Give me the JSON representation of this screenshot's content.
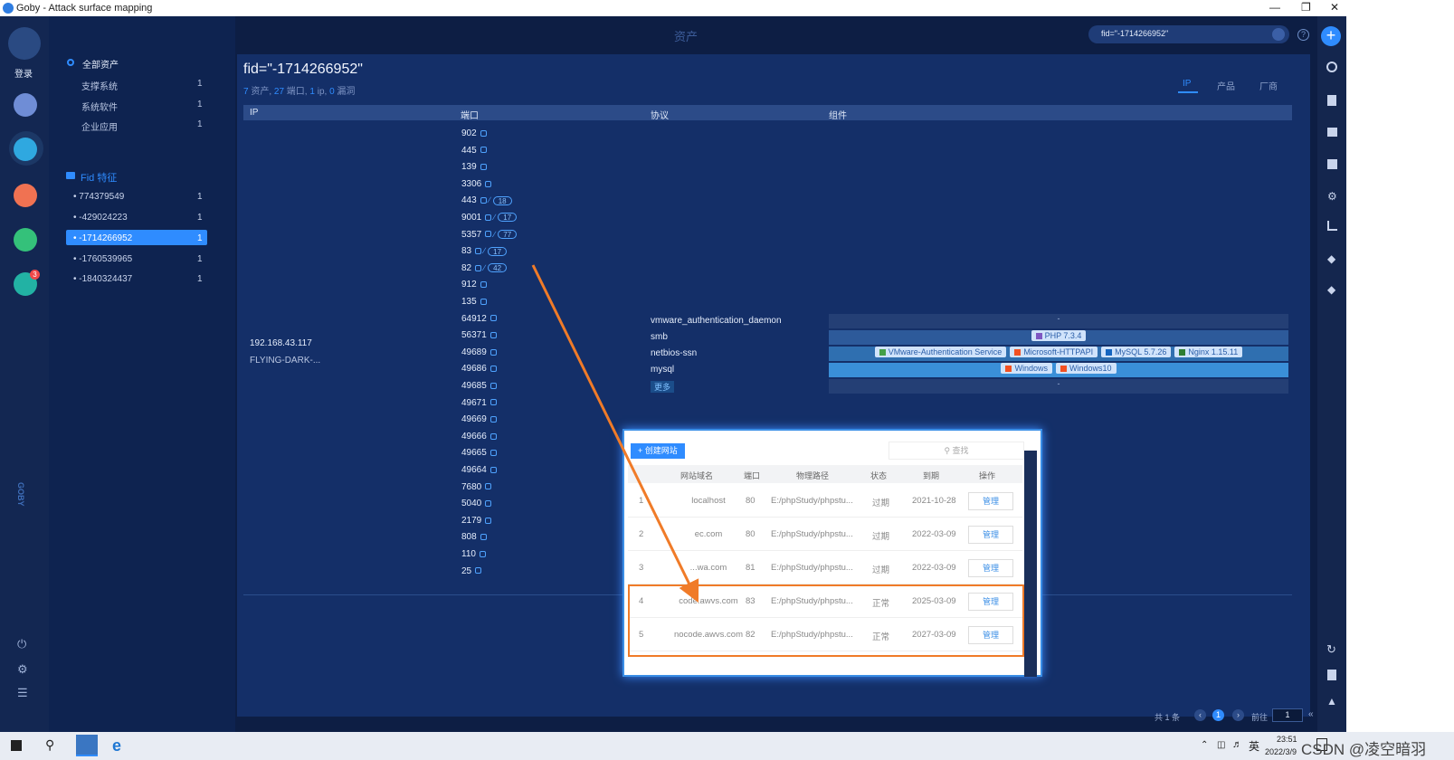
{
  "window": {
    "title": "Goby - Attack surface mapping"
  },
  "header": {
    "page_label": "资产",
    "search_value": "fid=\"-1714266952\""
  },
  "leftbar": {
    "login_label": "登录",
    "plugin_badge": "3",
    "brand": "GOBY"
  },
  "sidebar": {
    "all_assets_label": "全部资产",
    "tree": [
      {
        "label": "支撑系统",
        "count": "1"
      },
      {
        "label": "系统软件",
        "count": "1"
      },
      {
        "label": "企业应用",
        "count": "1"
      }
    ],
    "fid_header": "Fid 特征",
    "fid_items": [
      {
        "label": "774379549",
        "count": "1"
      },
      {
        "label": "-429024223",
        "count": "1"
      },
      {
        "label": "-1714266952",
        "count": "1",
        "active": true
      },
      {
        "label": "-1760539965",
        "count": "1"
      },
      {
        "label": "-1840324437",
        "count": "1"
      }
    ]
  },
  "main": {
    "query_title": "fid=\"-1714266952\"",
    "summary": {
      "assets_num": "7",
      "assets_label": " 资产, ",
      "ports_num": "27",
      "ports_label": " 端口, ",
      "ip_num": "1",
      "ip_label": " ip, ",
      "vuln_num": "0",
      "vuln_label": " 漏洞"
    },
    "view_tabs": [
      "IP",
      "产品",
      "厂商"
    ],
    "columns": [
      "IP",
      "端口",
      "协议",
      "组件"
    ],
    "host": {
      "ip": "192.168.43.117",
      "hostname": "FLYING-DARK-..."
    },
    "ports": [
      {
        "p": "902"
      },
      {
        "p": "445"
      },
      {
        "p": "139"
      },
      {
        "p": "3306"
      },
      {
        "p": "443",
        "badge": "18"
      },
      {
        "p": "9001",
        "badge": "17"
      },
      {
        "p": "5357",
        "badge": "77"
      },
      {
        "p": "83",
        "badge": "17"
      },
      {
        "p": "82",
        "badge": "42"
      },
      {
        "p": "912"
      },
      {
        "p": "135"
      },
      {
        "p": "64912"
      },
      {
        "p": "56371"
      },
      {
        "p": "49689"
      },
      {
        "p": "49686"
      },
      {
        "p": "49685"
      },
      {
        "p": "49671"
      },
      {
        "p": "49669"
      },
      {
        "p": "49666"
      },
      {
        "p": "49665"
      },
      {
        "p": "49664"
      },
      {
        "p": "7680"
      },
      {
        "p": "5040"
      },
      {
        "p": "2179"
      },
      {
        "p": "808"
      },
      {
        "p": "110"
      },
      {
        "p": "25"
      }
    ],
    "protocols": [
      "vmware_authentication_daemon",
      "smb",
      "netbios-ssn",
      "mysql"
    ],
    "more_label": "更多",
    "components": {
      "row1": "-",
      "row2": [
        "PHP 7.3.4"
      ],
      "row3": [
        "VMware-Authentication Service",
        "Microsoft-HTTPAPI",
        "MySQL 5.7.26",
        "Nginx 1.15.11"
      ],
      "row4": [
        "Windows",
        "Windows10"
      ],
      "row5": "-"
    }
  },
  "popup": {
    "create_button": "创建网站",
    "search_placeholder": "查找",
    "headers": [
      "网站域名",
      "端口",
      "物理路径",
      "状态",
      "到期",
      "操作"
    ],
    "rows": [
      {
        "no": "1",
        "domain": "localhost",
        "port": "80",
        "path": "E:/phpStudy/phpstu...",
        "status": "过期",
        "expire": "2021-10-28",
        "action": "管理"
      },
      {
        "no": "2",
        "domain": "ec.com",
        "port": "80",
        "path": "E:/phpStudy/phpstu...",
        "status": "过期",
        "expire": "2022-03-09",
        "action": "管理"
      },
      {
        "no": "3",
        "domain": "...wa.com",
        "port": "81",
        "path": "E:/phpStudy/phpstu...",
        "status": "过期",
        "expire": "2022-03-09",
        "action": "管理"
      },
      {
        "no": "4",
        "domain": "code.awvs.com",
        "port": "83",
        "path": "E:/phpStudy/phpstu...",
        "status": "正常",
        "expire": "2025-03-09",
        "action": "管理"
      },
      {
        "no": "5",
        "domain": "nocode.awvs.com",
        "port": "82",
        "path": "E:/phpStudy/phpstu...",
        "status": "正常",
        "expire": "2027-03-09",
        "action": "管理"
      }
    ]
  },
  "pagination": {
    "total": "共 1 条",
    "current": "1",
    "goto_label": "前往",
    "goto_value": "1"
  },
  "taskbar": {
    "time": "23:51",
    "date": "2022/3/9",
    "ime": "英",
    "watermark": "CSDN @凌空暗羽"
  },
  "colors": {
    "accent": "#2f8cff",
    "annotation": "#f07b28",
    "active_item": "#2f8cff"
  }
}
